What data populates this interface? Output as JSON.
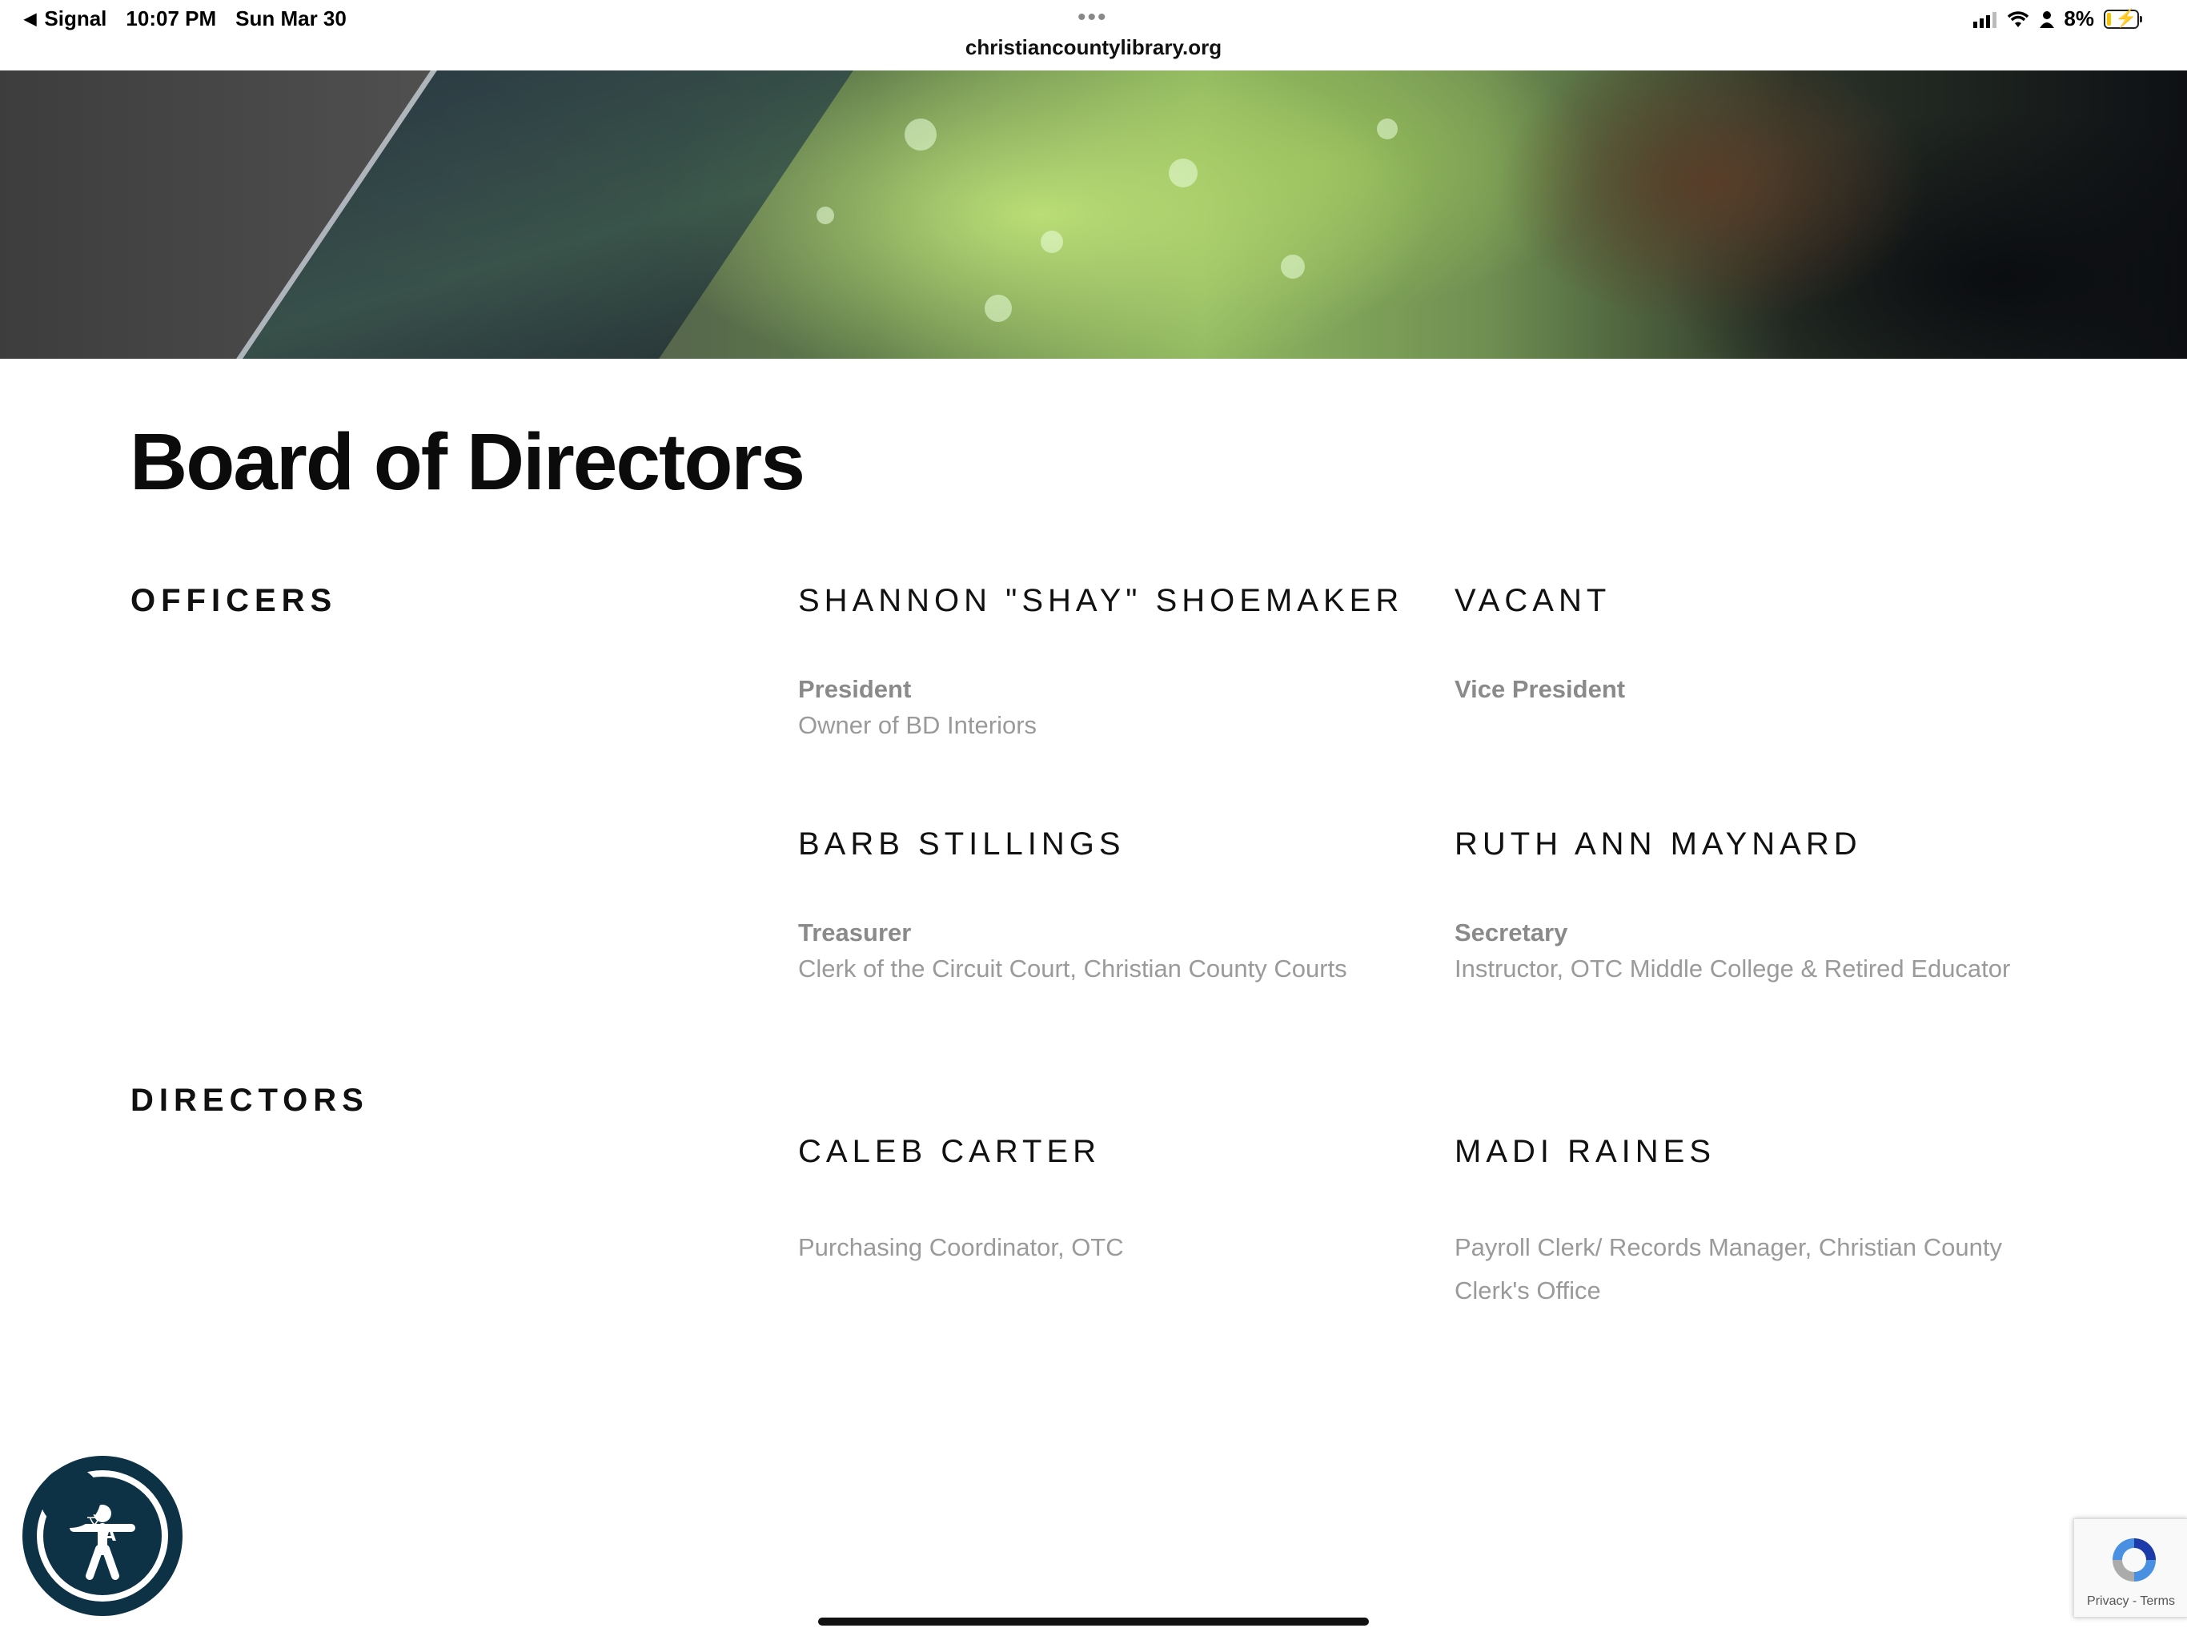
{
  "status_bar": {
    "back_app": "Signal",
    "time": "10:07 PM",
    "date": "Sun Mar 30",
    "url": "christiancountylibrary.org",
    "battery": "8%"
  },
  "page": {
    "title": "Board of Directors"
  },
  "officers": {
    "label": "OFFICERS",
    "members": [
      {
        "name": "SHANNON \"SHAY\" SHOEMAKER",
        "role": "President",
        "desc": "Owner of BD Interiors"
      },
      {
        "name": "VACANT",
        "role": "Vice President",
        "desc": ""
      },
      {
        "name": "BARB STILLINGS",
        "role": "Treasurer",
        "desc": "Clerk of the Circuit Court, Christian County Courts"
      },
      {
        "name": "RUTH ANN MAYNARD",
        "role": "Secretary",
        "desc": "Instructor, OTC Middle College & Retired Educator"
      }
    ]
  },
  "directors": {
    "label": "DIRECTORS",
    "members": [
      {
        "name": "CALEB CARTER",
        "desc_line1": "Purchasing Coordinator, OTC"
      },
      {
        "name": "MADI RAINES",
        "desc_line1": "Payroll Clerk/ Records Manager, Christian County",
        "desc_line2": "Clerk's Office"
      }
    ]
  },
  "recaptcha": {
    "privacy": "Privacy",
    "separator": " - ",
    "terms": "Terms"
  },
  "colors": {
    "accessibility_widget": "#0d3145",
    "role_text": "#8a8a8a",
    "desc_text": "#9a9a9a"
  }
}
